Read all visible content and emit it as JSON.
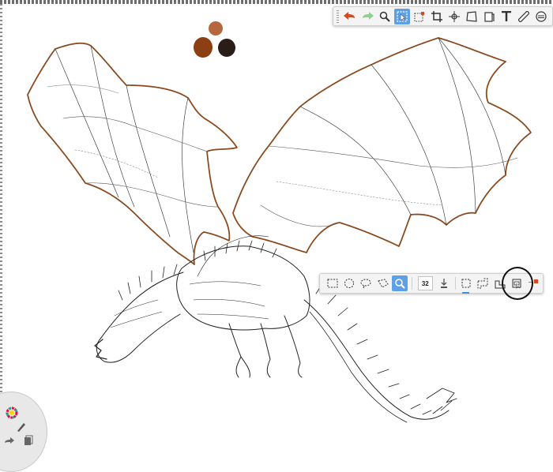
{
  "colors": {
    "swatch_light": "#b5683d",
    "swatch_mid": "#8c3f12",
    "swatch_dark": "#2a1c16",
    "accent": "#5ea0e6",
    "wing_outline": "#8a4a1f"
  },
  "top_toolbar": {
    "tools": [
      "undo-icon",
      "redo-icon",
      "zoom-icon",
      "select-icon",
      "transform-icon",
      "crop-icon",
      "symmetry-icon",
      "perspective-icon",
      "layer-icon",
      "text-icon",
      "ruler-icon",
      "steady-stroke-icon"
    ],
    "active_tool": "select-icon"
  },
  "selection_toolbar": {
    "tools": [
      "rect-select-icon",
      "ellipse-select-icon",
      "lasso-select-icon",
      "poly-select-icon",
      "magic-wand-icon"
    ],
    "brush_size": "32",
    "mode_tools": [
      "fill-icon",
      "new-selection-icon",
      "add-selection-icon",
      "subtract-selection-icon",
      "intersect-selection-icon",
      "color-indicator-icon"
    ]
  },
  "radial_menu": {
    "items": [
      "color-wheel-icon",
      "brush-icon",
      "redo-icon",
      "copy-icon"
    ]
  }
}
